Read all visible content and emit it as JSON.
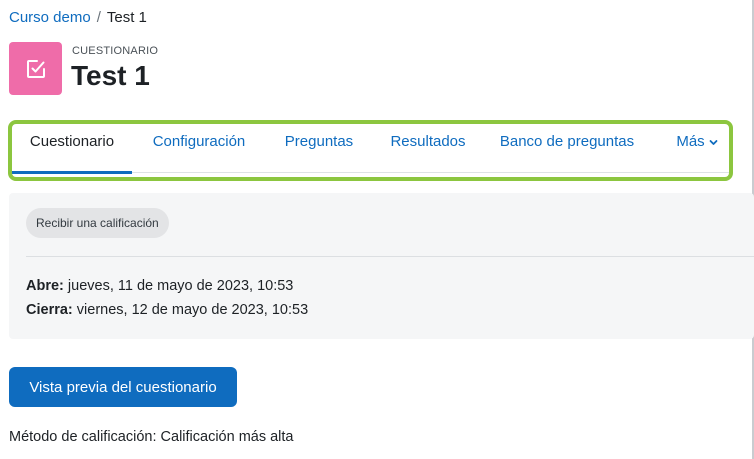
{
  "breadcrumb": {
    "course": "Curso demo",
    "separator": "/",
    "current": "Test 1"
  },
  "header": {
    "activity_type": "CUESTIONARIO",
    "title": "Test 1",
    "icon": "checkbox-icon",
    "icon_color": "#ef6ca9"
  },
  "tabs": [
    {
      "label": "Cuestionario",
      "active": true
    },
    {
      "label": "Configuración",
      "active": false
    },
    {
      "label": "Preguntas",
      "active": false
    },
    {
      "label": "Resultados",
      "active": false
    },
    {
      "label": "Banco de preguntas",
      "active": false
    },
    {
      "label": "Más",
      "active": false,
      "icon": "chevron-down-icon"
    }
  ],
  "info": {
    "badge": "Recibir una calificación",
    "open_label": "Abre:",
    "open_value": " jueves, 11 de mayo de 2023, 10:53",
    "close_label": "Cierra:",
    "close_value": " viernes, 12 de mayo de 2023, 10:53"
  },
  "actions": {
    "preview_button": "Vista previa del cuestionario"
  },
  "grading_method": "Método de calificación: Calificación más alta",
  "colors": {
    "primary": "#0f6cbf",
    "highlight": "#8cc63f",
    "icon_bg": "#ef6ca9"
  }
}
